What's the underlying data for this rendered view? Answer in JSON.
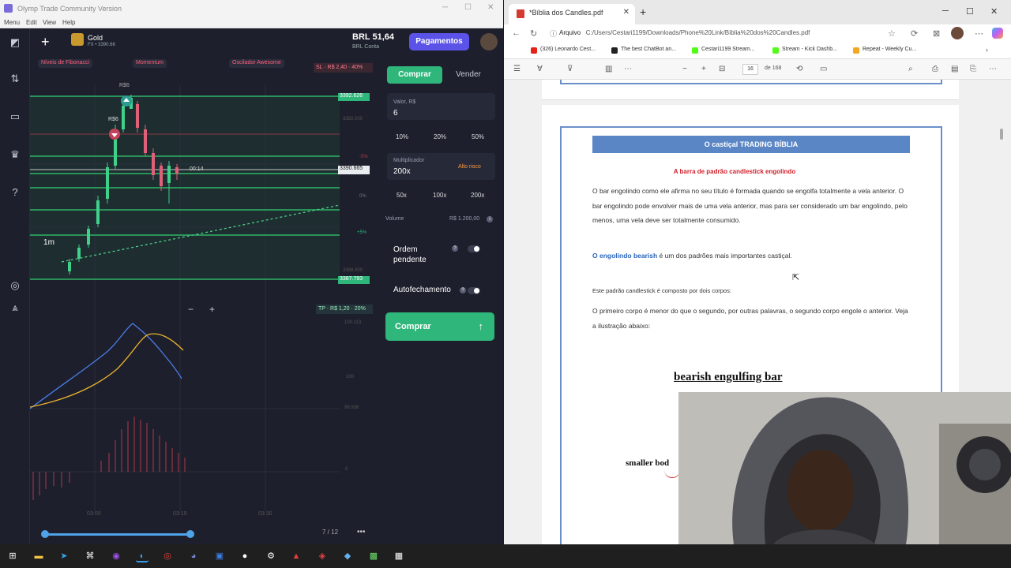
{
  "trading": {
    "window_title": "Olymp Trade Community Version",
    "menu": [
      "Menu",
      "Edit",
      "View",
      "Help"
    ],
    "asset": {
      "name": "Gold",
      "sub": "FX • 3390.66"
    },
    "balance": {
      "amount": "BRL 51,64",
      "account": "BRL Conta"
    },
    "payments_label": "Pagamentos",
    "indicators": [
      "Níveis de Fibonacci",
      "Momentum",
      "Oscilador Awesome"
    ],
    "sl_label": "SL · R$ 2,40 · 40%",
    "tp_label": "TP · R$ 1,20 · 20%",
    "price_top": "3392.626",
    "price_mid": "3390.665",
    "price_low": "3387.793",
    "timer": "00:14",
    "timeframe": "1m",
    "scale_labels": [
      "3392.000",
      "-5%",
      "0%",
      "+5%",
      "3388.000",
      "100.113",
      "100",
      "99.936",
      "0"
    ],
    "time_labels": [
      "03:00",
      "03:15",
      "03:30"
    ],
    "markers": [
      "R$6",
      "R$6"
    ],
    "page_indicator": "7 / 12",
    "panel": {
      "tab_buy": "Comprar",
      "tab_sell": "Vender",
      "value_label": "Valor, R$",
      "value": "6",
      "pcts": [
        "10%",
        "20%",
        "50%"
      ],
      "mult_label": "Multiplicador",
      "mult_value": "200x",
      "risk_label": "Alto risco",
      "mults": [
        "50x",
        "100x",
        "200x"
      ],
      "volume_label": "Volume",
      "volume_value": "R$ 1.200,00",
      "pending_label": "Ordem pendente",
      "autoclose_label": "Autofechamento",
      "buy_button": "Comprar"
    },
    "colors": {
      "buy": "#2fb67a",
      "accent": "#5b53e8",
      "bg": "#1d1f2c"
    }
  },
  "browser": {
    "tab_title": "*Bíblia dos Candles.pdf",
    "url_prefix": "Arquivo",
    "url": "C:/Users/Cestari1199/Downloads/Phone%20Link/Bíblia%20dos%20Candles.pdf",
    "bookmarks": [
      "(326) Leonardo Cest...",
      "The best ChatBot an...",
      "Cestari1199 Stream...",
      "Stream - Kick Dashb...",
      "Repeat - Weekly Cu..."
    ],
    "page_num": "16",
    "page_total": "de 168",
    "pdf": {
      "header": "O castiçal TRADING BÍBLIA",
      "subtitle": "A barra de padrão candlestick engolindo",
      "p1": "O bar engolindo como ele afirma no seu título é formada quando se engolfa totalmente a vela anterior. O bar engolindo pode envolver mais de uma vela anterior, mas para ser considerado um bar engolindo, pelo menos, uma vela deve ser totalmente consumido.",
      "p2_highlight": "O engolindo bearish",
      "p2_rest": " é um dos padrões mais importantes castiçal.",
      "p3": "Este padrão candlestick é composto por dois corpos:",
      "p4": "O primeiro corpo é menor do que o segundo, por outras palavras, o segundo corpo engole o anterior. Veja a ilustração abaixo:",
      "figure_title": "bearish engulfing bar",
      "figure_label": "smaller bod"
    }
  }
}
